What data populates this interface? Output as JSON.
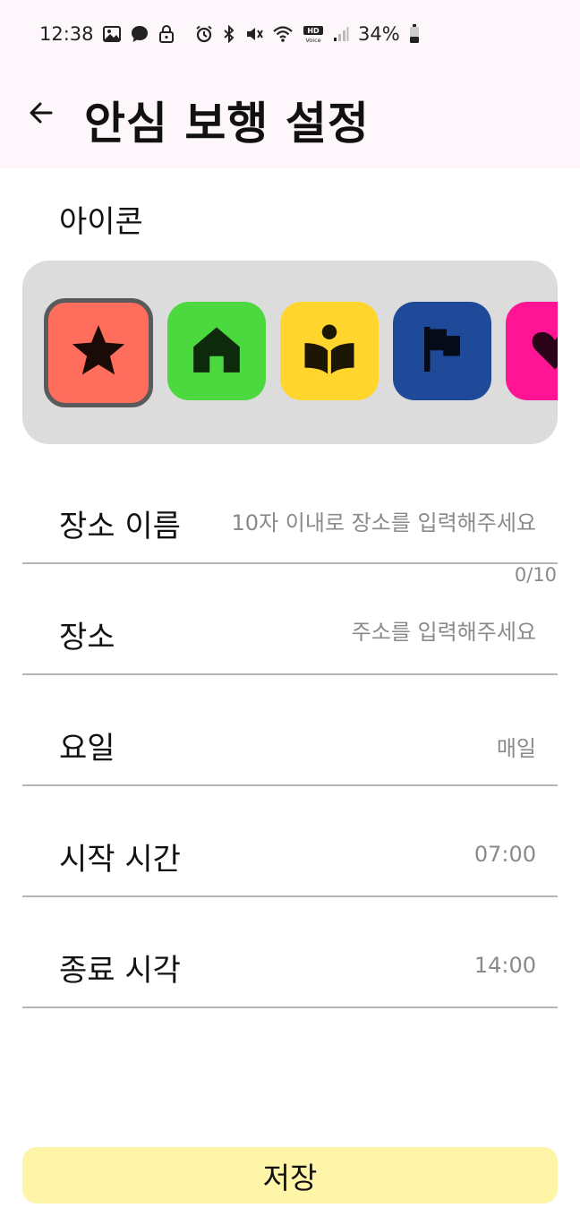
{
  "status_bar": {
    "time": "12:38",
    "battery": "34%",
    "left_icons": [
      "gallery-icon",
      "chat-icon",
      "lock-icon"
    ],
    "right_icons": [
      "alarm-icon",
      "bluetooth-icon",
      "mute-icon",
      "wifi-icon",
      "hd-voice-icon",
      "signal-icon",
      "battery-icon"
    ]
  },
  "header": {
    "title": "안심 보행 설정",
    "back_icon": "arrow-left-icon"
  },
  "icon_section": {
    "label": "아이콘",
    "options": [
      {
        "name": "star",
        "color": "#ff6d5c",
        "selected": true
      },
      {
        "name": "home",
        "color": "#4cd93f",
        "selected": false
      },
      {
        "name": "book-reader",
        "color": "#ffd52e",
        "selected": false
      },
      {
        "name": "flag",
        "color": "#1f4a9a",
        "selected": false
      },
      {
        "name": "heart",
        "color": "#ff1493",
        "selected": false
      }
    ]
  },
  "form": {
    "place_name": {
      "label": "장소 이름",
      "value": "",
      "placeholder": "10자 이내로 장소를 입력해주세요",
      "counter": "0/10"
    },
    "place": {
      "label": "장소",
      "value": "",
      "placeholder": "주소를 입력해주세요"
    },
    "days": {
      "label": "요일",
      "value": "매일"
    },
    "start_time": {
      "label": "시작 시간",
      "value": "07:00"
    },
    "end_time": {
      "label": "종료 시각",
      "value": "14:00"
    }
  },
  "save_button": {
    "label": "저장",
    "color": "#fff5a8"
  }
}
